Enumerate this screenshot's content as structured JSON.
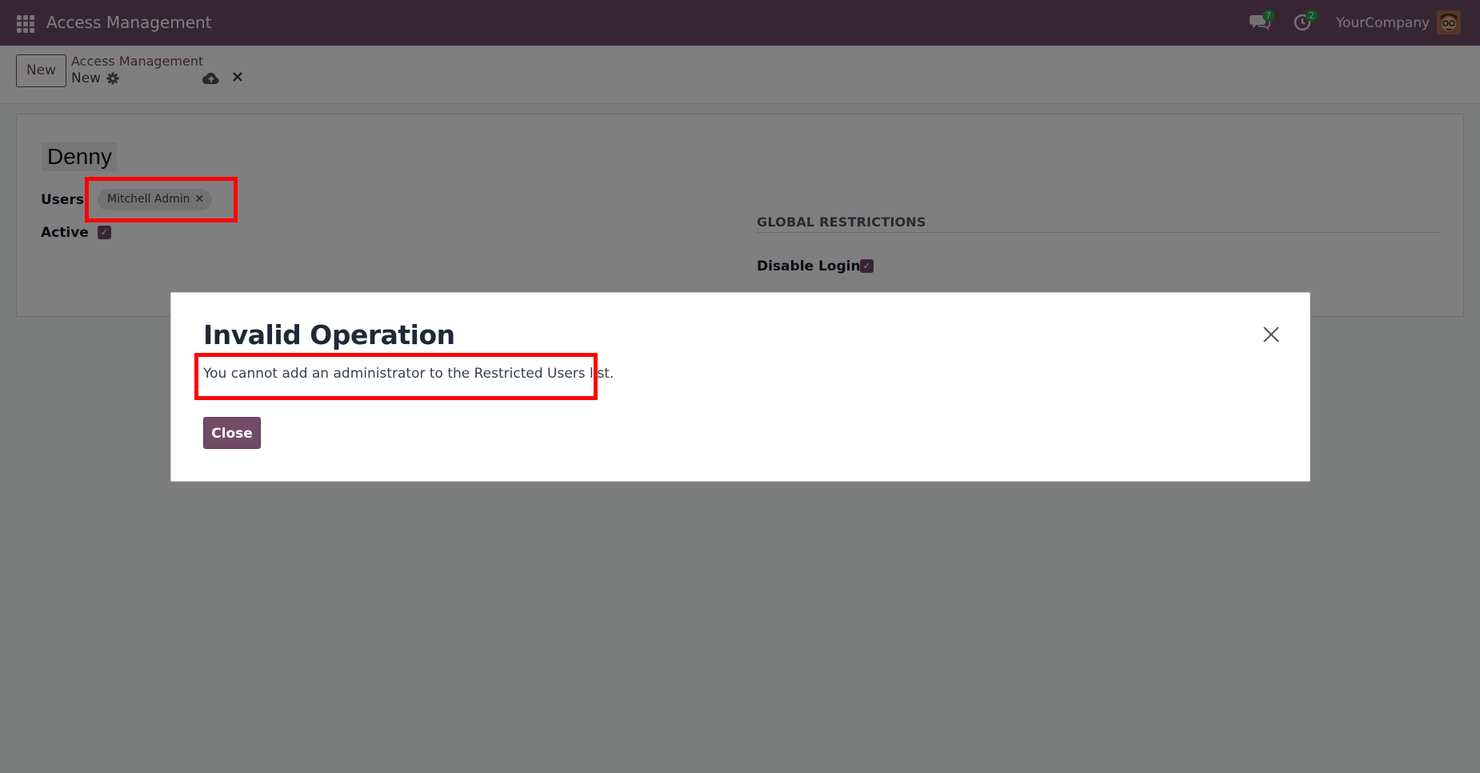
{
  "navbar": {
    "app_title": "Access Management",
    "messages_count": "7",
    "activities_count": "2",
    "company": "YourCompany",
    "apps_icon": "apps-grid-icon",
    "messages_icon": "chat-icon",
    "activities_icon": "clock-icon"
  },
  "control_panel": {
    "new_button": "New",
    "breadcrumb_parent": "Access Management",
    "breadcrumb_current": "New",
    "gear_icon": "gear-icon",
    "save_icon": "cloud-upload-icon",
    "discard_icon": "close-icon"
  },
  "form": {
    "name": "Denny",
    "users_label": "Users",
    "users_tags": [
      "Mitchell Admin"
    ],
    "active_label": "Active",
    "active_checked": true,
    "section_title": "GLOBAL RESTRICTIONS",
    "disable_login_label": "Disable Login",
    "disable_login_checked": true
  },
  "dialog": {
    "title": "Invalid Operation",
    "message": "You cannot add an administrator to the Restricted Users list.",
    "close_button": "Close",
    "close_icon": "close-icon"
  },
  "colors": {
    "brand": "#714b67",
    "highlight": "#ff0000",
    "badge": "#28a745"
  }
}
